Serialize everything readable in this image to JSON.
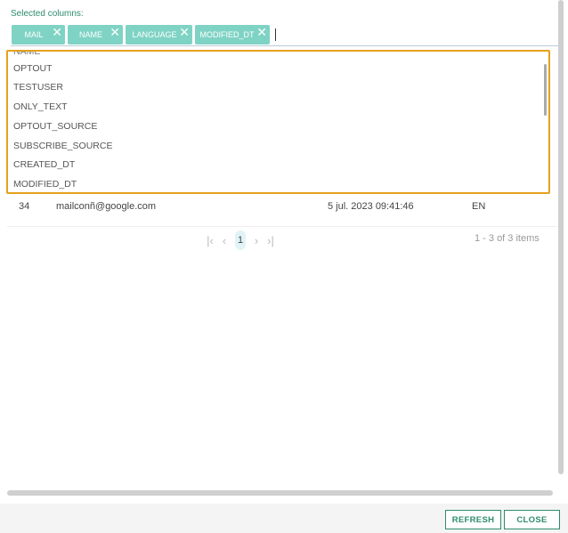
{
  "selected_columns": {
    "label": "Selected columns:",
    "chips": [
      {
        "label": "MAIL"
      },
      {
        "label": "NAME"
      },
      {
        "label": "LANGUAGE"
      },
      {
        "label": "MODIFIED_DT"
      }
    ],
    "remove_glyph": "✕"
  },
  "dropdown": {
    "cut_item": "NAME",
    "options": [
      "OPTOUT",
      "TESTUSER",
      "ONLY_TEXT",
      "OPTOUT_SOURCE",
      "SUBSCRIBE_SOURCE",
      "CREATED_DT",
      "MODIFIED_DT"
    ]
  },
  "table": {
    "row": {
      "id": "34",
      "mail": "mailconñ@google.com",
      "modified": "5 jul. 2023 09:41:46",
      "language": "EN"
    }
  },
  "pagination": {
    "first_glyph": "|‹",
    "prev_glyph": "‹",
    "current_page": "1",
    "next_glyph": "›",
    "last_glyph": "›|",
    "count_text": "1 - 3 of 3 items"
  },
  "footer": {
    "refresh_label": "REFRESH",
    "close_label": "CLOSE"
  },
  "colors": {
    "chip": "#7fd3c4",
    "accent": "#2e8b6e",
    "dropdown_border": "#e5a11c"
  }
}
